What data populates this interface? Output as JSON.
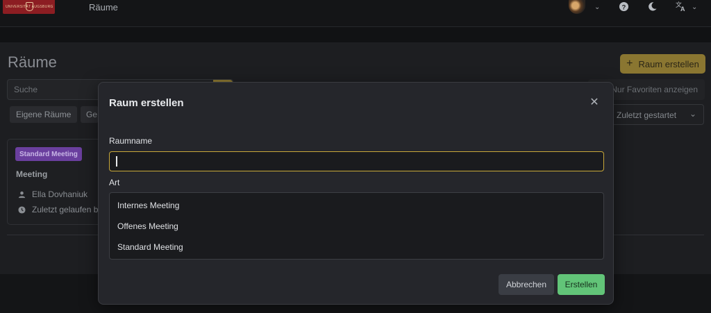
{
  "topbar": {
    "logo_text": "UNIVERSITÄT AUGSBURG",
    "title": "Räume",
    "avatar_icon": "user-avatar",
    "help_icon": "help-circle-icon",
    "theme_icon": "moon-icon",
    "language_icon": "translate-icon"
  },
  "page": {
    "title": "Räume",
    "create_button": "Raum erstellen",
    "search_placeholder": "Suche",
    "favorites_button": "Nur Favoriten anzeigen",
    "filters": [
      "Eigene Räume",
      "Ge"
    ],
    "sort_value": "Zuletzt gestartet"
  },
  "card": {
    "badge": "Standard Meeting",
    "title": "Meeting",
    "owner": "Ella Dovhaniuk",
    "last_run": "Zuletzt gelaufen b"
  },
  "modal": {
    "title": "Raum erstellen",
    "name_label": "Raumname",
    "name_value": "",
    "type_label": "Art",
    "options": [
      "Internes Meeting",
      "Offenes Meeting",
      "Standard Meeting"
    ],
    "cancel_button": "Abbrechen",
    "submit_button": "Erstellen"
  },
  "colors": {
    "accent": "#8a7631",
    "focus_border": "#c9a93a",
    "badge": "#6a3f9e",
    "submit": "#62c478"
  }
}
